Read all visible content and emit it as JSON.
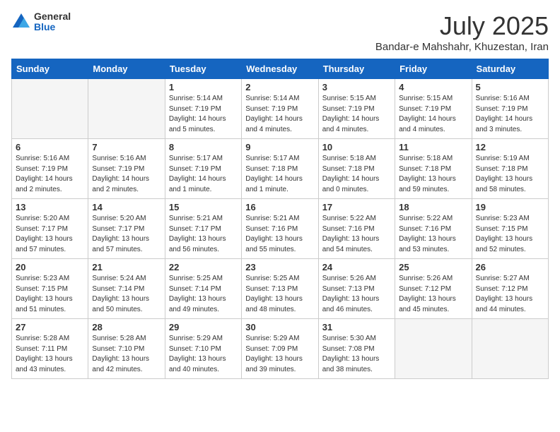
{
  "header": {
    "logo_general": "General",
    "logo_blue": "Blue",
    "month_title": "July 2025",
    "subtitle": "Bandar-e Mahshahr, Khuzestan, Iran"
  },
  "weekdays": [
    "Sunday",
    "Monday",
    "Tuesday",
    "Wednesday",
    "Thursday",
    "Friday",
    "Saturday"
  ],
  "weeks": [
    [
      {
        "num": "",
        "info": "",
        "empty": true
      },
      {
        "num": "",
        "info": "",
        "empty": true
      },
      {
        "num": "1",
        "info": "Sunrise: 5:14 AM\nSunset: 7:19 PM\nDaylight: 14 hours\nand 5 minutes.",
        "empty": false
      },
      {
        "num": "2",
        "info": "Sunrise: 5:14 AM\nSunset: 7:19 PM\nDaylight: 14 hours\nand 4 minutes.",
        "empty": false
      },
      {
        "num": "3",
        "info": "Sunrise: 5:15 AM\nSunset: 7:19 PM\nDaylight: 14 hours\nand 4 minutes.",
        "empty": false
      },
      {
        "num": "4",
        "info": "Sunrise: 5:15 AM\nSunset: 7:19 PM\nDaylight: 14 hours\nand 4 minutes.",
        "empty": false
      },
      {
        "num": "5",
        "info": "Sunrise: 5:16 AM\nSunset: 7:19 PM\nDaylight: 14 hours\nand 3 minutes.",
        "empty": false
      }
    ],
    [
      {
        "num": "6",
        "info": "Sunrise: 5:16 AM\nSunset: 7:19 PM\nDaylight: 14 hours\nand 2 minutes.",
        "empty": false
      },
      {
        "num": "7",
        "info": "Sunrise: 5:16 AM\nSunset: 7:19 PM\nDaylight: 14 hours\nand 2 minutes.",
        "empty": false
      },
      {
        "num": "8",
        "info": "Sunrise: 5:17 AM\nSunset: 7:19 PM\nDaylight: 14 hours\nand 1 minute.",
        "empty": false
      },
      {
        "num": "9",
        "info": "Sunrise: 5:17 AM\nSunset: 7:18 PM\nDaylight: 14 hours\nand 1 minute.",
        "empty": false
      },
      {
        "num": "10",
        "info": "Sunrise: 5:18 AM\nSunset: 7:18 PM\nDaylight: 14 hours\nand 0 minutes.",
        "empty": false
      },
      {
        "num": "11",
        "info": "Sunrise: 5:18 AM\nSunset: 7:18 PM\nDaylight: 13 hours\nand 59 minutes.",
        "empty": false
      },
      {
        "num": "12",
        "info": "Sunrise: 5:19 AM\nSunset: 7:18 PM\nDaylight: 13 hours\nand 58 minutes.",
        "empty": false
      }
    ],
    [
      {
        "num": "13",
        "info": "Sunrise: 5:20 AM\nSunset: 7:17 PM\nDaylight: 13 hours\nand 57 minutes.",
        "empty": false
      },
      {
        "num": "14",
        "info": "Sunrise: 5:20 AM\nSunset: 7:17 PM\nDaylight: 13 hours\nand 57 minutes.",
        "empty": false
      },
      {
        "num": "15",
        "info": "Sunrise: 5:21 AM\nSunset: 7:17 PM\nDaylight: 13 hours\nand 56 minutes.",
        "empty": false
      },
      {
        "num": "16",
        "info": "Sunrise: 5:21 AM\nSunset: 7:16 PM\nDaylight: 13 hours\nand 55 minutes.",
        "empty": false
      },
      {
        "num": "17",
        "info": "Sunrise: 5:22 AM\nSunset: 7:16 PM\nDaylight: 13 hours\nand 54 minutes.",
        "empty": false
      },
      {
        "num": "18",
        "info": "Sunrise: 5:22 AM\nSunset: 7:16 PM\nDaylight: 13 hours\nand 53 minutes.",
        "empty": false
      },
      {
        "num": "19",
        "info": "Sunrise: 5:23 AM\nSunset: 7:15 PM\nDaylight: 13 hours\nand 52 minutes.",
        "empty": false
      }
    ],
    [
      {
        "num": "20",
        "info": "Sunrise: 5:23 AM\nSunset: 7:15 PM\nDaylight: 13 hours\nand 51 minutes.",
        "empty": false
      },
      {
        "num": "21",
        "info": "Sunrise: 5:24 AM\nSunset: 7:14 PM\nDaylight: 13 hours\nand 50 minutes.",
        "empty": false
      },
      {
        "num": "22",
        "info": "Sunrise: 5:25 AM\nSunset: 7:14 PM\nDaylight: 13 hours\nand 49 minutes.",
        "empty": false
      },
      {
        "num": "23",
        "info": "Sunrise: 5:25 AM\nSunset: 7:13 PM\nDaylight: 13 hours\nand 48 minutes.",
        "empty": false
      },
      {
        "num": "24",
        "info": "Sunrise: 5:26 AM\nSunset: 7:13 PM\nDaylight: 13 hours\nand 46 minutes.",
        "empty": false
      },
      {
        "num": "25",
        "info": "Sunrise: 5:26 AM\nSunset: 7:12 PM\nDaylight: 13 hours\nand 45 minutes.",
        "empty": false
      },
      {
        "num": "26",
        "info": "Sunrise: 5:27 AM\nSunset: 7:12 PM\nDaylight: 13 hours\nand 44 minutes.",
        "empty": false
      }
    ],
    [
      {
        "num": "27",
        "info": "Sunrise: 5:28 AM\nSunset: 7:11 PM\nDaylight: 13 hours\nand 43 minutes.",
        "empty": false
      },
      {
        "num": "28",
        "info": "Sunrise: 5:28 AM\nSunset: 7:10 PM\nDaylight: 13 hours\nand 42 minutes.",
        "empty": false
      },
      {
        "num": "29",
        "info": "Sunrise: 5:29 AM\nSunset: 7:10 PM\nDaylight: 13 hours\nand 40 minutes.",
        "empty": false
      },
      {
        "num": "30",
        "info": "Sunrise: 5:29 AM\nSunset: 7:09 PM\nDaylight: 13 hours\nand 39 minutes.",
        "empty": false
      },
      {
        "num": "31",
        "info": "Sunrise: 5:30 AM\nSunset: 7:08 PM\nDaylight: 13 hours\nand 38 minutes.",
        "empty": false
      },
      {
        "num": "",
        "info": "",
        "empty": true
      },
      {
        "num": "",
        "info": "",
        "empty": true
      }
    ]
  ]
}
